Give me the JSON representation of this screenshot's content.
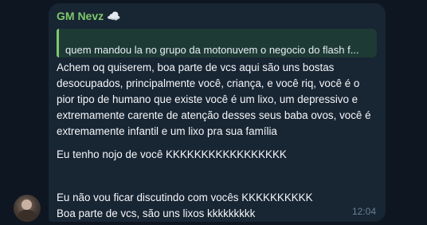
{
  "message": {
    "sender": "GM Nevz",
    "sender_emoji": "☁️",
    "reply_preview": "quem mandou la no grupo da motonuvem o negocio do flash f...",
    "paragraphs": [
      "Achem oq quiserem, boa parte de vcs aqui são uns bostas desocupados, principalmente você, criança, e você riq, você é o pior tipo de humano que existe você é um lixo, um depressivo e extremamente carente de atenção desses seus baba ovos, você é extremamente infantil e um lixo pra sua família",
      "Eu tenho nojo de você KKKKKKKKKKKKKKKKK",
      "Eu não vou ficar discutindo com vocês KKKKKKKKKK Boa parte de vcs, são uns lixos kkkkkkkkk"
    ],
    "time": "12:04"
  },
  "colors": {
    "background": "#0e1621",
    "bubble": "#182533",
    "sender_name": "#7ec86a",
    "reply_bar": "#7ec86a",
    "reply_bg": "#1e3a34",
    "text": "#f5f7fa",
    "time": "#6c7f91"
  },
  "icons": {
    "sender_badge": "cloud-emoji",
    "avatar": "user-avatar-photo"
  }
}
